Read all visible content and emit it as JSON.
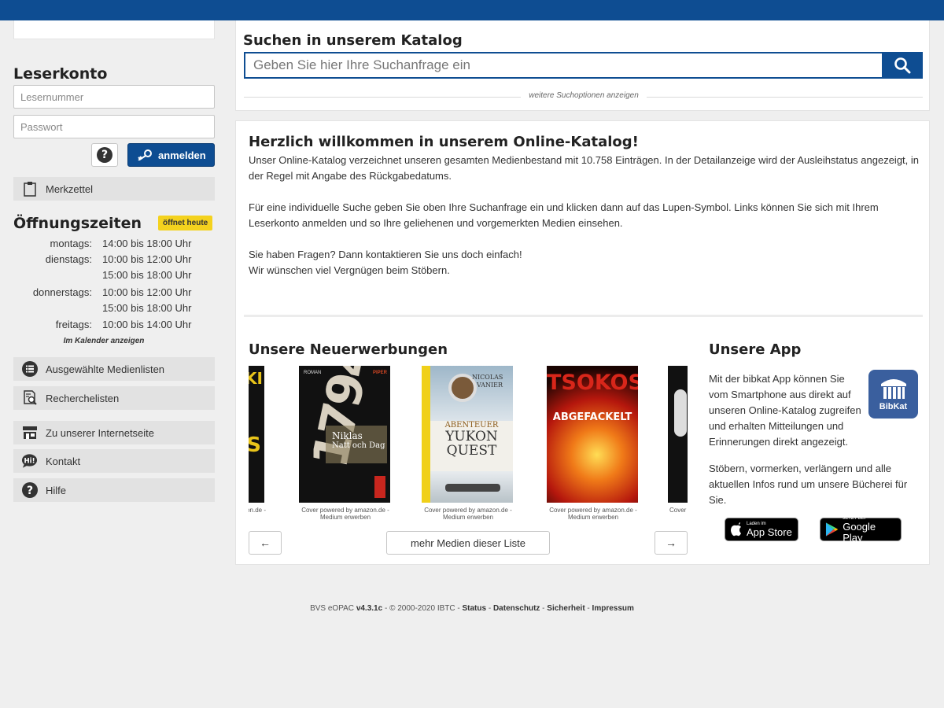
{
  "sidebar": {
    "account_title": "Leserkonto",
    "reader_number_placeholder": "Lesernummer",
    "password_placeholder": "Passwort",
    "login_label": "anmelden",
    "help_glyph": "?",
    "memo_label": "Merkzettel",
    "opening_title": "Öffnungszeiten",
    "opening_badge": "öffnet heute",
    "hours": [
      {
        "day": "montags:",
        "time": "14:00 bis 18:00 Uhr"
      },
      {
        "day": "dienstags:",
        "time": "10:00 bis 12:00 Uhr"
      },
      {
        "day": "",
        "time": "15:00 bis 18:00 Uhr"
      },
      {
        "day": "donnerstags:",
        "time": "10:00 bis 12:00 Uhr"
      },
      {
        "day": "",
        "time": "15:00 bis 18:00 Uhr"
      },
      {
        "day": "freitags:",
        "time": "10:00 bis 14:00 Uhr"
      }
    ],
    "calendar_link": "Im Kalender anzeigen",
    "menu": [
      {
        "label": "Ausgewählte Medienlisten",
        "icon": "list-icon"
      },
      {
        "label": "Recherchelisten",
        "icon": "research-list-icon"
      },
      {
        "label": "Zu unserer Internetseite",
        "icon": "store-icon"
      },
      {
        "label": "Kontakt",
        "icon": "chat-icon"
      },
      {
        "label": "Hilfe",
        "icon": "help-icon"
      }
    ]
  },
  "search": {
    "title": "Suchen in unserem Katalog",
    "placeholder": "Geben Sie hier Ihre Suchanfrage ein",
    "more_options": "weitere Suchoptionen anzeigen"
  },
  "welcome": {
    "title": "Herzlich willkommen in unserem Online-Katalog!",
    "p1": "Unser Online-Katalog verzeichnet unseren gesamten Medienbestand mit 10.758 Einträgen. In der Detailanzeige wird der Ausleihstatus angezeigt, in der Regel mit Angabe des Rückgabedatums.",
    "p2": "Für eine individuelle Suche geben Sie oben Ihre Suchanfrage ein und klicken dann auf das Lupen-Symbol. Links können Sie sich mit Ihrem Leserkonto anmelden und so Ihre geliehenen und vorgemerkten Medien einsehen.",
    "p3a": "Sie haben Fragen? Dann kontaktieren Sie uns doch einfach!",
    "p3b": "Wir wünschen viel Vergnügen beim Stöbern."
  },
  "new_items": {
    "title": "Unsere Neuerwerbungen",
    "books": [
      {
        "caption": "azon.de -",
        "cover_text": [
          "KI",
          "S"
        ]
      },
      {
        "caption": "Cover powered by amazon.de - Medium erwerben",
        "cover_text": [
          "ROMAN",
          "1794",
          "Niklas",
          "Natt och Dag",
          "PIPER"
        ]
      },
      {
        "caption": "Cover powered by amazon.de - Medium erwerben",
        "cover_text": [
          "NICOLAS",
          "VANIER",
          "ABENTEUER",
          "YUKON",
          "QUEST"
        ]
      },
      {
        "caption": "Cover powered by amazon.de - Medium erwerben",
        "cover_text": [
          "TSOKOS",
          "ABGEFACKELT"
        ]
      },
      {
        "caption": "Cover",
        "cover_text": []
      }
    ],
    "prev": "←",
    "next": "→",
    "more_label": "mehr Medien dieser Liste"
  },
  "app": {
    "title": "Unsere App",
    "text1": "Mit der bibkat App können Sie vom Smartphone aus direkt auf unseren Online-Katalog zugreifen und erhalten Mitteilungen und Erinnerungen direkt angezeigt.",
    "text2": "Stöbern, vormerken, verlängern und alle aktuellen Infos rund um unsere Bücherei für Sie.",
    "logo_text": "BibKat",
    "appstore_small": "Laden im",
    "appstore_large": "App Store",
    "gplay_small": "JETZT BEI",
    "gplay_large": "Google Play"
  },
  "footer": {
    "prefix": "BVS eOPAC ",
    "version": "v4.3.1c",
    "copyright": " - © 2000-2020 IBTC - ",
    "links": [
      "Status",
      "Datenschutz",
      "Sicherheit",
      "Impressum"
    ]
  },
  "colors": {
    "brand_blue": "#0e4d92",
    "badge_yellow": "#f4d21e"
  }
}
